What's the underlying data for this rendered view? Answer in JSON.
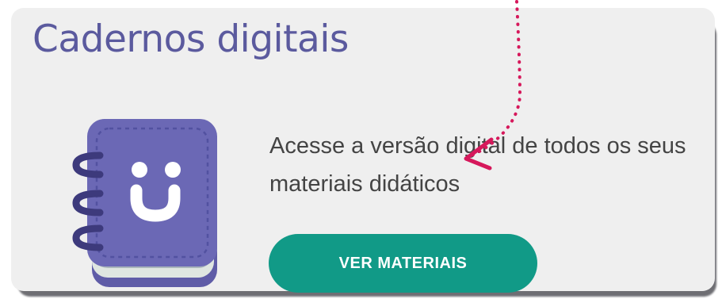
{
  "card": {
    "title": "Cadernos digitais",
    "description": "Acesse a versão digital de todos os seus materiais didáticos",
    "button_label": "VER MATERIAIS"
  },
  "icons": {
    "illustration": "notebook-smile-icon",
    "pointer": "dotted-arrow-icon"
  },
  "colors": {
    "title": "#5b5a9e",
    "notebook_cover": "#6b68b5",
    "button": "#119a87",
    "button_text": "#ffffff",
    "arrow": "#d6185b",
    "card_background": "#efefef"
  }
}
